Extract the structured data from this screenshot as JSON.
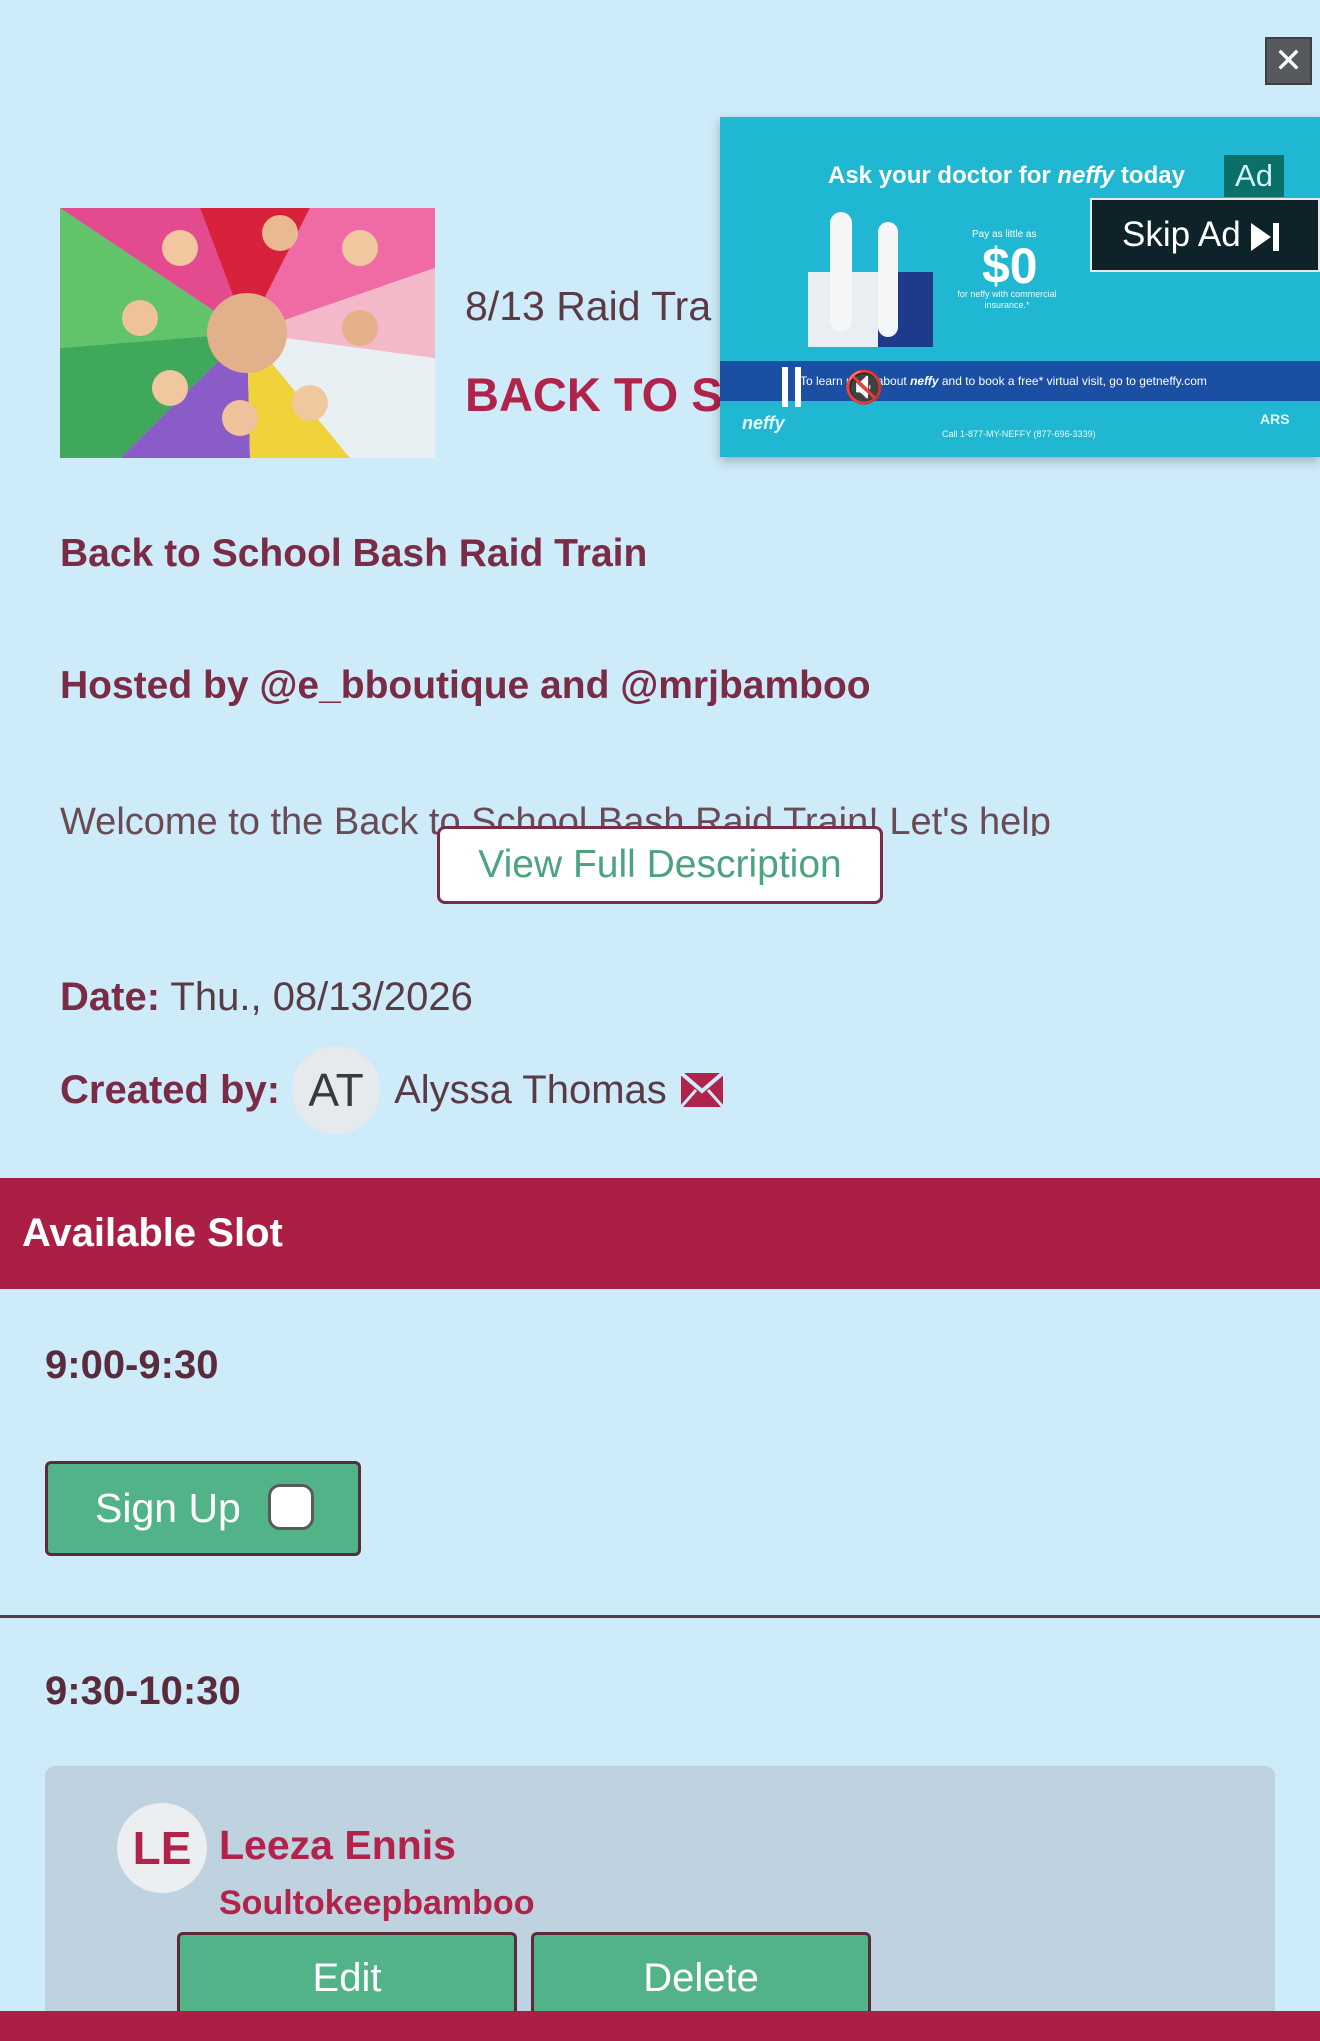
{
  "close_symbol": "✕",
  "event": {
    "subtitle": "8/13 Raid Tra",
    "title": "BACK TO S",
    "name": "Back to School Bash Raid Train",
    "hosted_by": "Hosted by @e_bboutique and @mrjbamboo",
    "description_preview": "Welcome to the Back to School Bash Raid Train! Let's help",
    "view_full_label": "View Full Description",
    "date_label": "Date:",
    "date_value": "Thu., 08/13/2026",
    "created_by_label": "Created by:",
    "creator_initials": "AT",
    "creator_name": "Alyssa Thomas",
    "image_icon": "group-hands-photo",
    "mail_icon": "envelope-icon"
  },
  "ad": {
    "headline_prefix": "Ask your doctor for ",
    "headline_brand": "neffy",
    "headline_suffix": " today",
    "badge": "Ad",
    "skip_label": "Skip Ad",
    "price_note": "Pay as little as",
    "price": "$0",
    "price_sub": "for neffy with commercial insurance.*",
    "strip_prefix": "To learn more about ",
    "strip_brand": "neffy",
    "strip_suffix": " and to book a free* virtual visit, go to getneffy.com",
    "logo": "neffy",
    "call": "Call 1-877-MY-NEFFY (877-696-3339)",
    "ars": "ARS"
  },
  "slots": {
    "section_title": "Available Slot",
    "slot1": {
      "time": "9:00-9:30",
      "signup_label": "Sign Up"
    },
    "slot2": {
      "time": "9:30-10:30",
      "signee_initials": "LE",
      "signee_name": "Leeza Ennis",
      "signee_sub": "Soultokeepbamboo",
      "edit_label": "Edit",
      "delete_label": "Delete"
    }
  },
  "colors": {
    "background": "#cdebf8",
    "accent": "#ab1f44",
    "button_green": "#52b388",
    "text_maroon": "#7a2b45"
  }
}
